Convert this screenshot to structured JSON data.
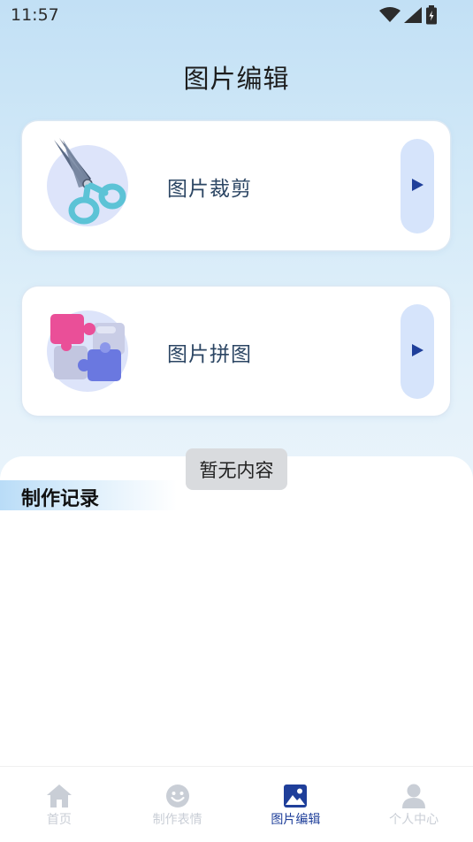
{
  "status_bar": {
    "time": "11:57"
  },
  "header": {
    "title": "图片编辑"
  },
  "cards": [
    {
      "label": "图片裁剪",
      "icon": "scissors-icon"
    },
    {
      "label": "图片拼图",
      "icon": "puzzle-icon"
    }
  ],
  "records": {
    "title": "制作记录"
  },
  "toast": {
    "message": "暂无内容"
  },
  "tab_bar": {
    "items": [
      {
        "label": "首页",
        "icon": "home-icon",
        "active": false
      },
      {
        "label": "制作表情",
        "icon": "smiley-icon",
        "active": false
      },
      {
        "label": "图片编辑",
        "icon": "image-icon",
        "active": true
      },
      {
        "label": "个人中心",
        "icon": "person-icon",
        "active": false
      }
    ]
  },
  "colors": {
    "accent": "#1f3f9a",
    "tab_inactive": "#c9ced6",
    "card_button": "#d6e4fb",
    "background_top": "#c2e0f5"
  }
}
